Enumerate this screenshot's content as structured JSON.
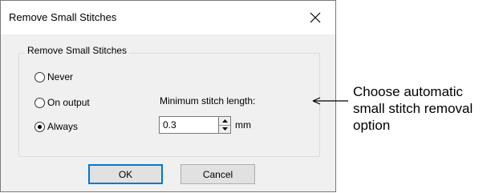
{
  "dialog": {
    "title": "Remove Small Stitches",
    "group_label": "Remove Small Stitches",
    "options": [
      {
        "label": "Never",
        "checked": false
      },
      {
        "label": "On output",
        "checked": false
      },
      {
        "label": "Always",
        "checked": true
      }
    ],
    "min_length_label": "Minimum stitch length:",
    "min_length_value": "0.3",
    "unit": "mm",
    "ok_label": "OK",
    "cancel_label": "Cancel"
  },
  "annotation": {
    "text": "Choose automatic\nsmall stitch removal\noption"
  },
  "colors": {
    "dialog_bg": "#f0f0f0",
    "titlebar_bg": "#ffffff",
    "focus_border": "#0078d7"
  },
  "icons": {
    "close": "close-icon",
    "arrow": "arrow-left-icon",
    "spin_up": "spin-up-icon",
    "spin_down": "spin-down-icon"
  }
}
